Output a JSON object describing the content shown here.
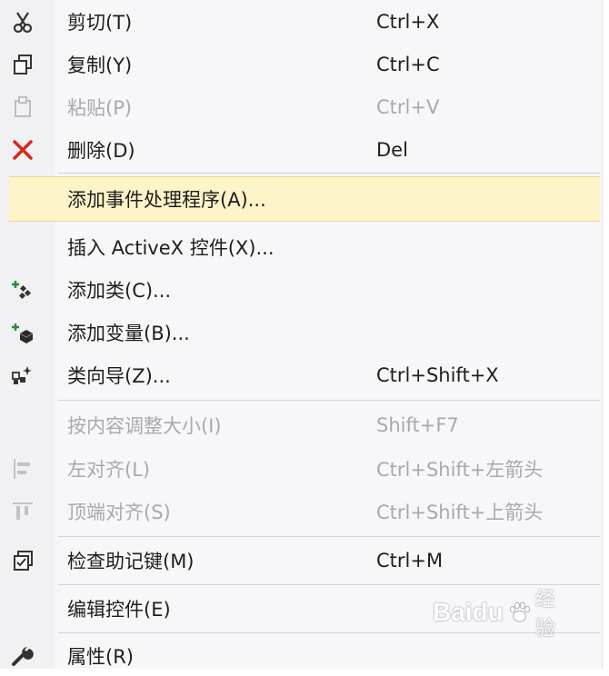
{
  "menu": {
    "items": [
      {
        "label": "剪切(T)",
        "shortcut": "Ctrl+X",
        "icon": "scissors-icon",
        "enabled": true
      },
      {
        "label": "复制(Y)",
        "shortcut": "Ctrl+C",
        "icon": "copy-icon",
        "enabled": true
      },
      {
        "label": "粘贴(P)",
        "shortcut": "Ctrl+V",
        "icon": "paste-icon",
        "enabled": false
      },
      {
        "label": "删除(D)",
        "shortcut": "Del",
        "icon": "delete-x-icon",
        "enabled": true
      },
      {
        "label": "添加事件处理程序(A)...",
        "shortcut": "",
        "icon": "",
        "enabled": true,
        "highlighted": true
      },
      {
        "label": "插入 ActiveX 控件(X)...",
        "shortcut": "",
        "icon": "",
        "enabled": true
      },
      {
        "label": "添加类(C)...",
        "shortcut": "",
        "icon": "add-class-icon",
        "enabled": true
      },
      {
        "label": "添加变量(B)...",
        "shortcut": "",
        "icon": "add-variable-icon",
        "enabled": true
      },
      {
        "label": "类向导(Z)...",
        "shortcut": "Ctrl+Shift+X",
        "icon": "class-wizard-icon",
        "enabled": true
      },
      {
        "label": "按内容调整大小(I)",
        "shortcut": "Shift+F7",
        "icon": "",
        "enabled": false
      },
      {
        "label": "左对齐(L)",
        "shortcut": "Ctrl+Shift+左箭头",
        "icon": "align-left-icon",
        "enabled": false
      },
      {
        "label": "顶端对齐(S)",
        "shortcut": "Ctrl+Shift+上箭头",
        "icon": "align-top-icon",
        "enabled": false
      },
      {
        "label": "检查助记键(M)",
        "shortcut": "Ctrl+M",
        "icon": "check-mnemonics-icon",
        "enabled": true
      },
      {
        "label": "编辑控件(E)",
        "shortcut": "",
        "icon": "",
        "enabled": true
      },
      {
        "label": "属性(R)",
        "shortcut": "",
        "icon": "wrench-icon",
        "enabled": true
      }
    ]
  },
  "watermark": {
    "brand": "Baidu",
    "suffix": "经验"
  },
  "colors": {
    "highlight": "#fdf4c8",
    "delete_red": "#d9261c",
    "add_green": "#2e8b3a",
    "disabled_text": "#a9a9ad"
  }
}
